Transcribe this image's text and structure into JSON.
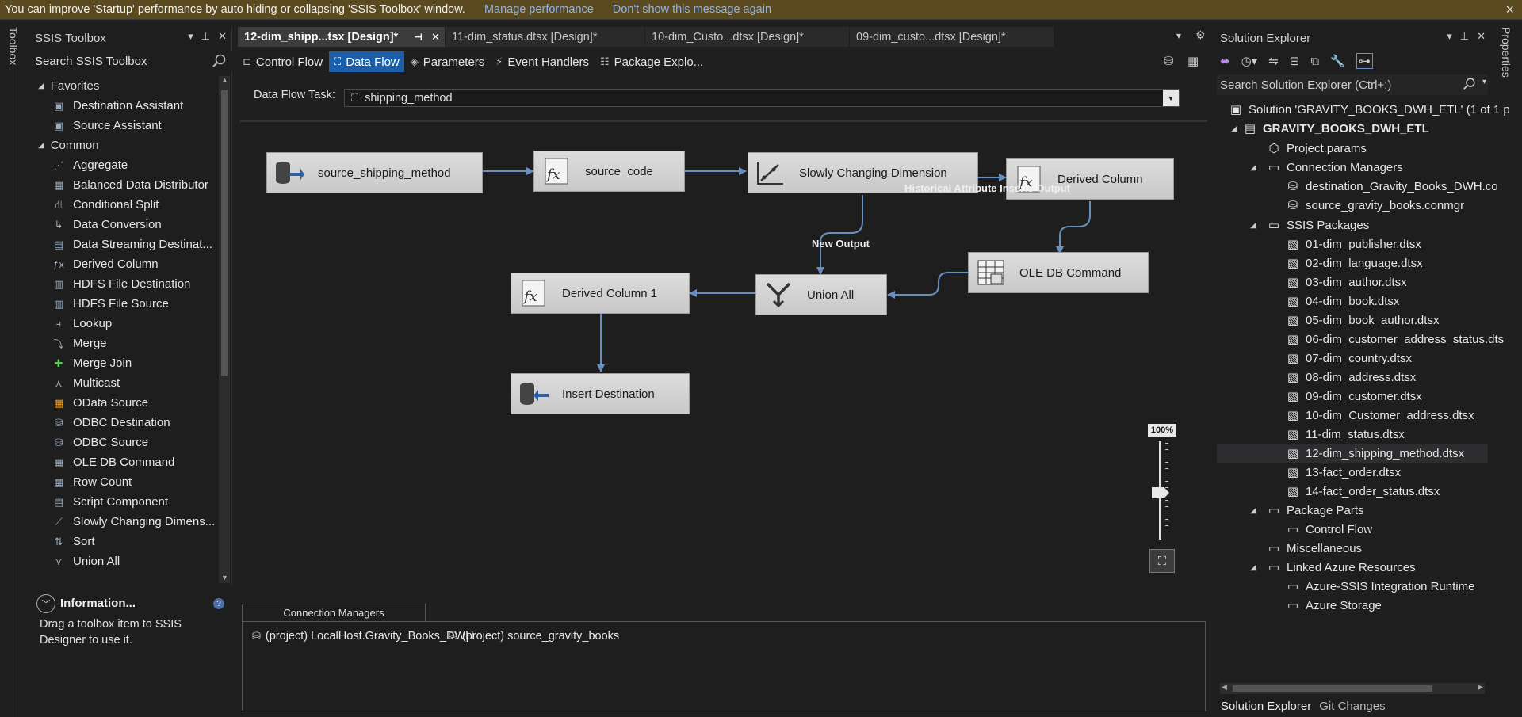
{
  "infobar": {
    "message": "You can improve 'Startup' performance by auto hiding or collapsing 'SSIS Toolbox' window.",
    "link_manage": "Manage performance",
    "link_dismiss": "Don't show this message again",
    "close": "×"
  },
  "side_strips": {
    "left": "Toolbox",
    "right": "Properties"
  },
  "toolbox": {
    "title": "SSIS Toolbox",
    "search_label": "Search SSIS Toolbox",
    "groups": [
      {
        "label": "Favorites",
        "items": [
          "Destination Assistant",
          "Source Assistant"
        ]
      },
      {
        "label": "Common",
        "items": [
          "Aggregate",
          "Balanced Data Distributor",
          "Conditional Split",
          "Data Conversion",
          "Data Streaming Destinat...",
          "Derived Column",
          "HDFS File Destination",
          "HDFS File Source",
          "Lookup",
          "Merge",
          "Merge Join",
          "Multicast",
          "OData Source",
          "ODBC Destination",
          "ODBC Source",
          "OLE DB Command",
          "Row Count",
          "Script Component",
          "Slowly Changing Dimens...",
          "Sort",
          "Union All"
        ]
      }
    ]
  },
  "information": {
    "title": "Information...",
    "text": "Drag a toolbox item to SSIS Designer to use it."
  },
  "tabs": [
    {
      "label": "12-dim_shipp...tsx [Design]*",
      "active": true
    },
    {
      "label": "11-dim_status.dtsx [Design]*",
      "active": false
    },
    {
      "label": "10-dim_Custo...dtsx [Design]*",
      "active": false
    },
    {
      "label": "09-dim_custo...dtsx [Design]*",
      "active": false
    }
  ],
  "designer_tabs": [
    "Control Flow",
    "Data Flow",
    "Parameters",
    "Event Handlers",
    "Package Explo..."
  ],
  "active_designer_tab": "Data Flow",
  "data_flow_task": {
    "label": "Data Flow Task:",
    "value": "shipping_method"
  },
  "nodes": {
    "source_shipping_method": "source_shipping_method",
    "source_code": "source_code",
    "scd": "Slowly Changing Dimension",
    "derived_column": "Derived Column",
    "ole_db_command": "OLE DB Command",
    "union_all": "Union All",
    "derived_column_1": "Derived Column 1",
    "insert_destination": "Insert Destination"
  },
  "edge_labels": {
    "historical": "Historical Attribute Inserts Output",
    "new_output": "New Output"
  },
  "zoom": {
    "label": "100%",
    "level_percent": 100
  },
  "connection_managers": {
    "tab": "Connection Managers",
    "items": [
      "(project) LocalHost.Gravity_Books_DWH",
      "(project) source_gravity_books"
    ]
  },
  "solution_explorer": {
    "title": "Solution Explorer",
    "search_placeholder": "Search Solution Explorer (Ctrl+;)",
    "solution": "Solution 'GRAVITY_BOOKS_DWH_ETL' (1 of 1 p",
    "project": "GRAVITY_BOOKS_DWH_ETL",
    "project_params": "Project.params",
    "connection_managers": "Connection Managers",
    "conn_items": [
      "destination_Gravity_Books_DWH.co",
      "source_gravity_books.conmgr"
    ],
    "ssis_packages": "SSIS Packages",
    "packages": [
      "01-dim_publisher.dtsx",
      "02-dim_language.dtsx",
      "03-dim_author.dtsx",
      "04-dim_book.dtsx",
      "05-dim_book_author.dtsx",
      "06-dim_customer_address_status.dts",
      "07-dim_country.dtsx",
      "08-dim_address.dtsx",
      "09-dim_customer.dtsx",
      "10-dim_Customer_address.dtsx",
      "11-dim_status.dtsx",
      "12-dim_shipping_method.dtsx",
      "13-fact_order.dtsx",
      "14-fact_order_status.dtsx"
    ],
    "selected_package": "12-dim_shipping_method.dtsx",
    "package_parts": "Package Parts",
    "control_flow": "Control Flow",
    "miscellaneous": "Miscellaneous",
    "linked_azure": "Linked Azure Resources",
    "azure_items": [
      "Azure-SSIS Integration Runtime",
      "Azure Storage"
    ]
  },
  "bottom_tabs": [
    "Solution Explorer",
    "Git Changes"
  ],
  "colors": {
    "accent": "#1d5ea8",
    "edge": "#6a8fbf",
    "infobar": "#5b4a1f"
  }
}
